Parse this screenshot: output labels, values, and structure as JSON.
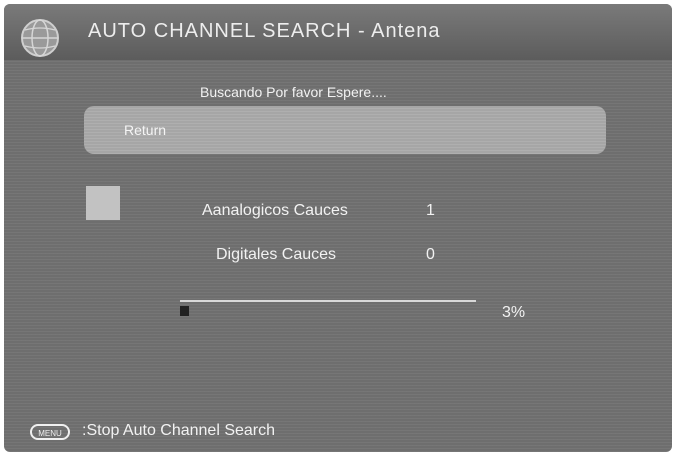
{
  "header": {
    "title": "AUTO CHANNEL SEARCH - Antena",
    "icon": "globe-icon"
  },
  "status": {
    "message": "Buscando Por favor Espere...."
  },
  "menu": {
    "return_label": "Return"
  },
  "results": {
    "analog_label": "Aanalogicos Cauces",
    "analog_count": "1",
    "digital_label": "Digitales Cauces",
    "digital_count": "0"
  },
  "progress": {
    "percent_text": "3%",
    "value": 0.03
  },
  "footer": {
    "key_label": "MENU",
    "hint": ":Stop Auto Channel Search"
  },
  "colors": {
    "background": "#6e6e6e",
    "highlight": "#a6a6a6",
    "text": "#f2f2f2"
  }
}
